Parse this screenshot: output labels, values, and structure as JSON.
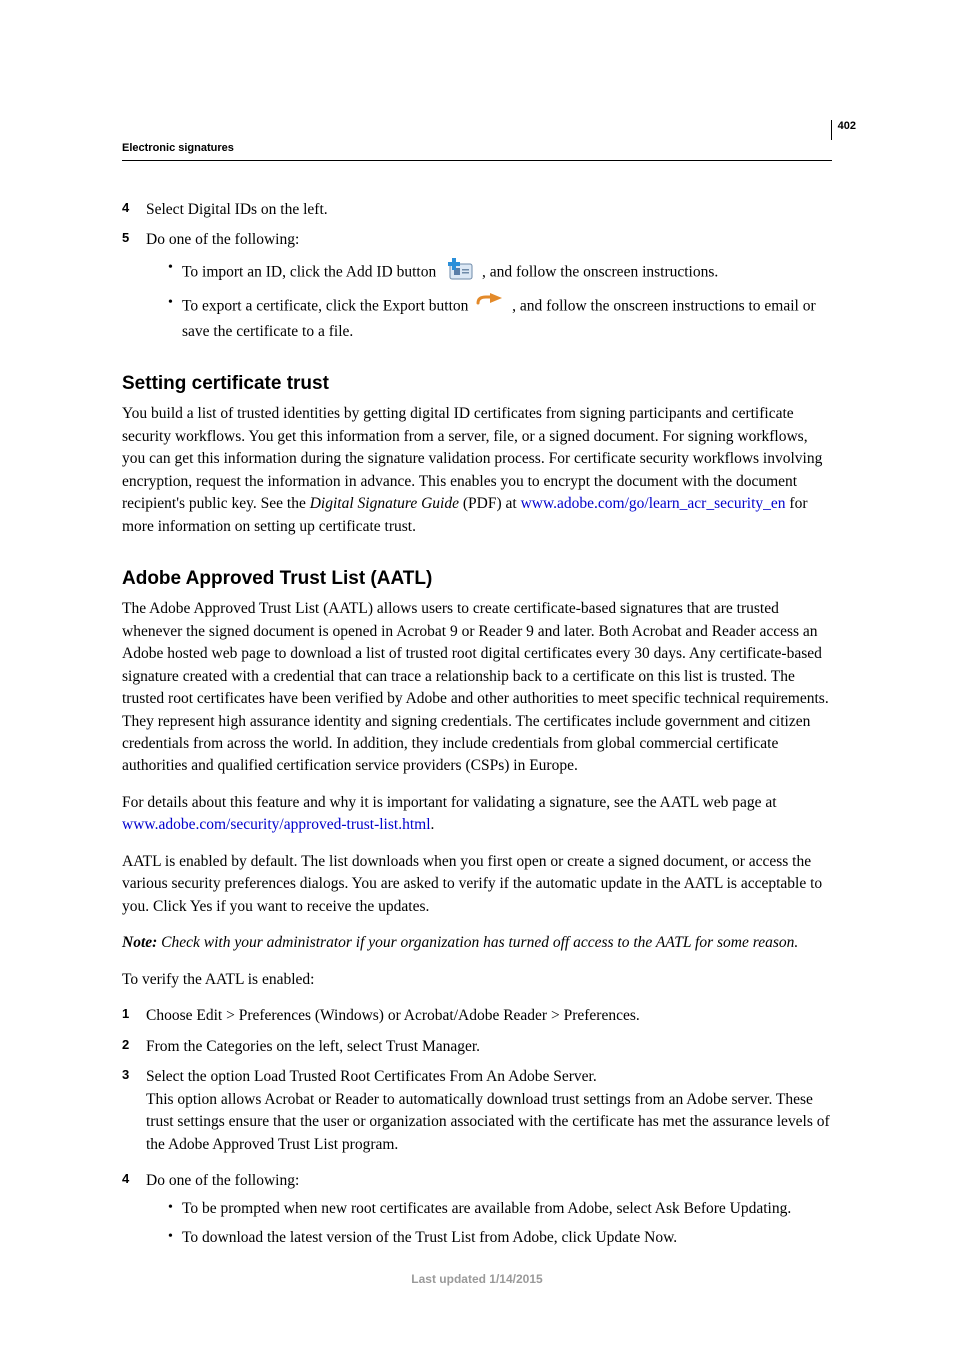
{
  "header": {
    "running_head": "Electronic signatures",
    "page_number": "402"
  },
  "top_steps": {
    "s4_num": "4",
    "s4_text": "Select Digital IDs on the left.",
    "s5_num": "5",
    "s5_text": "Do one of the following:",
    "s5_b1_a": "To import an ID, click the Add ID button ",
    "s5_b1_b": ", and follow the onscreen instructions.",
    "s5_b2_a": "To export a certificate, click the Export button ",
    "s5_b2_b": ", and follow the onscreen instructions to email or save the certificate to a file."
  },
  "section1": {
    "heading": "Setting certificate trust",
    "para_a": "You build a list of trusted identities by getting digital ID certificates from signing participants and certificate security workflows. You get this information from a server, file, or a signed document. For signing workflows, you can get this information during the signature validation process. For certificate security workflows involving encryption, request the information in advance. This enables you to encrypt the document with the document recipient's public key. See the ",
    "guide_name": "Digital Signature Guide",
    "para_b": " (PDF) at ",
    "link_text": "www.adobe.com/go/learn_acr_security_en",
    "para_c": " for more information on setting up certificate trust."
  },
  "section2": {
    "heading": "Adobe Approved Trust List (AATL)",
    "p1": "The Adobe Approved Trust List (AATL) allows users to create certificate-based signatures that are trusted whenever the signed document is opened in Acrobat 9 or Reader 9 and later. Both Acrobat and Reader access an Adobe hosted web page to download a list of trusted root digital certificates every 30 days. Any certificate-based signature created with a credential that can trace a relationship back to a certificate on this list is trusted. The trusted root certificates have been verified by Adobe and other authorities to meet specific technical requirements. They represent high assurance identity and signing credentials. The certificates include government and citizen credentials from across the world. In addition, they include credentials from global commercial certificate authorities and qualified certification service providers (CSPs) in Europe.",
    "p2_a": "For details about this feature and why it is important for validating a signature, see the AATL web page at ",
    "p2_link": "www.adobe.com/security/approved-trust-list.html",
    "p2_b": ".",
    "p3": "AATL is enabled by default. The list downloads when you first open or create a signed document, or access the various security preferences dialogs. You are asked to verify if the automatic update in the AATL is acceptable to you. Click Yes if you want to receive the updates.",
    "note_label": "Note:",
    "note_body": " Check with your administrator if your organization has turned off access to the AATL for some reason.",
    "p4": "To verify the AATL is enabled:",
    "steps": {
      "s1_num": "1",
      "s1": "Choose Edit > Preferences (Windows) or Acrobat/Adobe Reader > Preferences.",
      "s2_num": "2",
      "s2": "From the Categories on the left, select Trust Manager.",
      "s3_num": "3",
      "s3": "Select the option Load Trusted Root Certificates From An Adobe Server.",
      "s3_extra": "This option allows Acrobat or Reader to automatically download trust settings from an Adobe server. These trust settings ensure that the user or organization associated with the certificate has met the assurance levels of the Adobe Approved Trust List program.",
      "s4_num": "4",
      "s4": "Do one of the following:",
      "s4_b1": "To be prompted when new root certificates are available from Adobe, select Ask Before Updating.",
      "s4_b2": "To download the latest version of the Trust List from Adobe, click Update Now."
    }
  },
  "footer": {
    "text": "Last updated 1/14/2015"
  }
}
